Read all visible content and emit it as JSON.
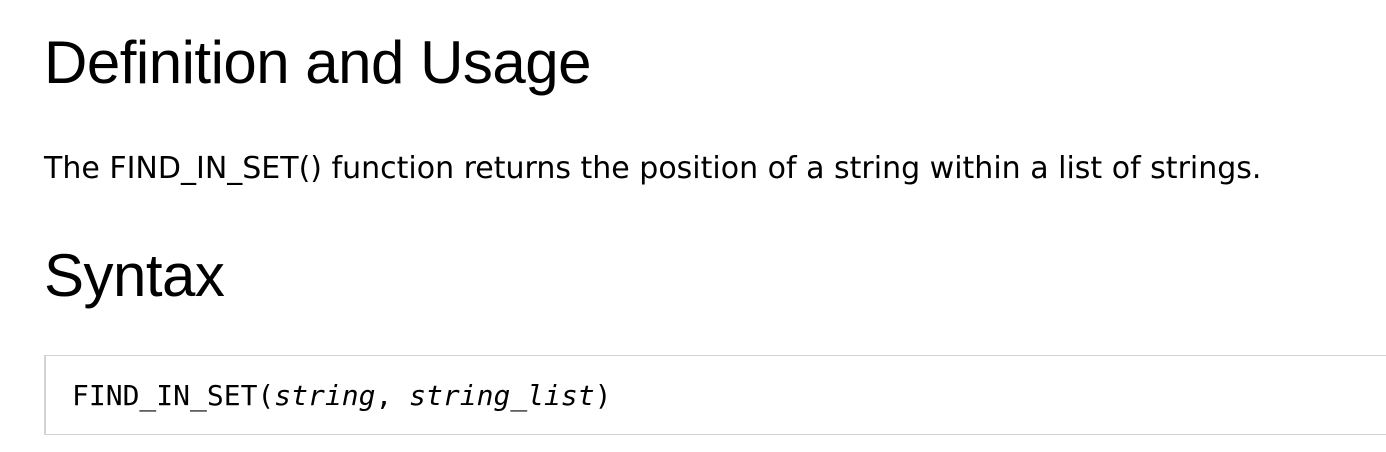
{
  "definition": {
    "heading": "Definition and Usage",
    "description": "The FIND_IN_SET() function returns the position of a string within a list of strings."
  },
  "syntax": {
    "heading": "Syntax",
    "code": {
      "function_name": "FIND_IN_SET(",
      "param1": "string",
      "separator": ", ",
      "param2": "string_list",
      "close": ")"
    }
  }
}
